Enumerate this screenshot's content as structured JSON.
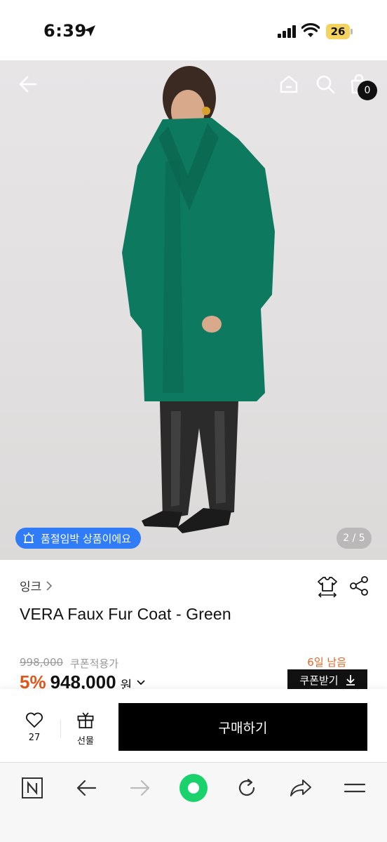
{
  "status_bar": {
    "time": "6:39",
    "battery": "26",
    "icons": [
      "location-arrow-icon",
      "signal-icon",
      "wifi-icon",
      "battery-icon"
    ]
  },
  "hero": {
    "nav_icons": [
      "back-arrow-icon",
      "home-icon",
      "search-icon",
      "shopping-bag-icon"
    ],
    "cart_count": "0",
    "stock_badge": "품절임박 상품이에요",
    "image_counter": "2 / 5"
  },
  "product": {
    "brand": "잉크",
    "title": "VERA Faux Fur Coat - Green",
    "original_price": "998,000",
    "coupon_note": "쿠폰적용가",
    "days_left": "6일 남음",
    "discount": "5%",
    "sale_price": "948,000",
    "currency": "원",
    "coupon_button": "쿠폰받기",
    "action_icons": [
      "size-guide-icon",
      "share-icon"
    ]
  },
  "purchase_bar": {
    "like_count": "27",
    "gift_label": "선물",
    "buy_label": "구매하기"
  },
  "browser_bar": {
    "icons": [
      "naver-n-icon",
      "back-icon",
      "forward-icon",
      "home-circle-icon",
      "refresh-icon",
      "share-arrow-icon",
      "menu-icon"
    ]
  },
  "colors": {
    "accent_blue": "#2f7cf6",
    "discount_orange": "#e0571a",
    "buy_button": "#000000",
    "coat_green": "#0d7a5f",
    "browser_green": "#19d26b"
  }
}
